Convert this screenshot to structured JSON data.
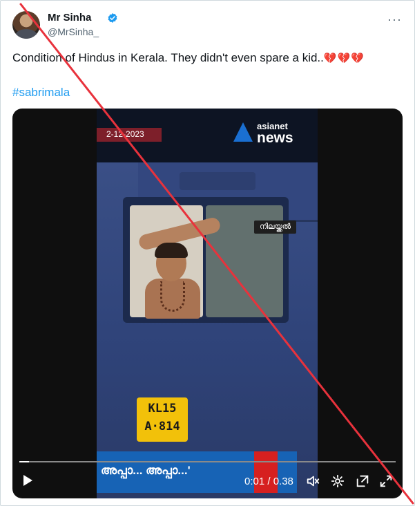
{
  "tweet": {
    "author": {
      "display_name": "Mr Sinha",
      "handle": "@MrSinha_",
      "verified": true
    },
    "more_label": "···",
    "text": "Condition of Hindus in Kerala. They didn't even spare a kid..",
    "emoji": "💔💔💔",
    "hashtag": "#sabrimala"
  },
  "video": {
    "date_tag": "2-12-2023",
    "channel_line1": "asianet",
    "channel_line2": "news",
    "location_tag": "നിലയ്ക്കൽ",
    "plate_line1": "KL15",
    "plate_line2": "A·814",
    "ticker_text": "അപ്പാ... അപ്പാ...'",
    "progress": 0.026,
    "time_display": "0:01 / 0.38"
  },
  "overlay": {
    "cross_color": "#e8323c"
  }
}
